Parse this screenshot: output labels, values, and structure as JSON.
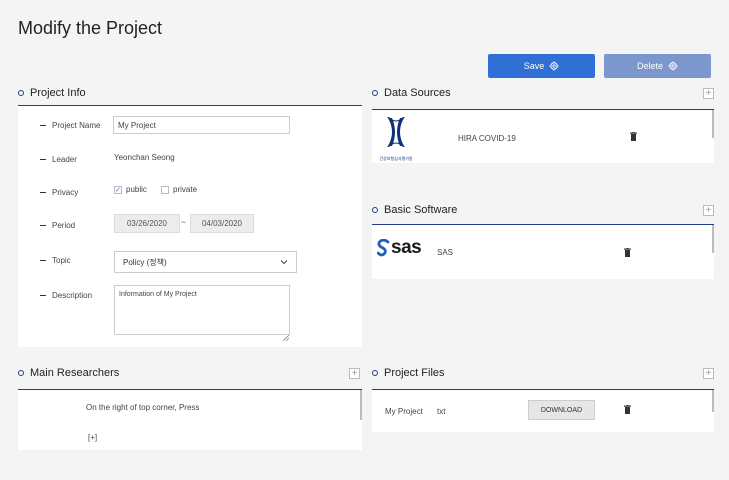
{
  "page": {
    "title": "Modify the Project"
  },
  "toolbar": {
    "save_label": "Save",
    "delete_label": "Delete"
  },
  "project_info": {
    "title": "Project Info",
    "fields": {
      "project_name": {
        "label": "Project Name",
        "value": "My Project"
      },
      "leader": {
        "label": "Leader",
        "value": "Yeonchan Seong"
      },
      "privacy": {
        "label": "Privacy",
        "public_label": "public",
        "private_label": "private",
        "public_checked": true,
        "private_checked": false
      },
      "period": {
        "label": "Period",
        "start": "03/26/2020",
        "separator": "~",
        "end": "04/03/2020"
      },
      "topic": {
        "label": "Topic",
        "value": "Policy (정책)"
      },
      "description": {
        "label": "Description",
        "value": "Information of My Project"
      }
    }
  },
  "data_sources": {
    "title": "Data Sources",
    "items": [
      {
        "logo_text": "건강보험심사평가원",
        "name": "HIRA COVID-19"
      }
    ]
  },
  "basic_software": {
    "title": "Basic Software",
    "items": [
      {
        "logo_text": "sas",
        "name": "SAS"
      }
    ]
  },
  "main_researchers": {
    "title": "Main Researchers",
    "hint": "On the right of top corner, Press",
    "plus_hint": "[+]"
  },
  "project_files": {
    "title": "Project Files",
    "items": [
      {
        "name": "My Project",
        "ext": "txt",
        "download_label": "DOWNLOAD"
      }
    ]
  },
  "colors": {
    "primary": "#2f6fd6",
    "secondary": "#7c97cc",
    "accent_line": "#1f3d8a"
  }
}
